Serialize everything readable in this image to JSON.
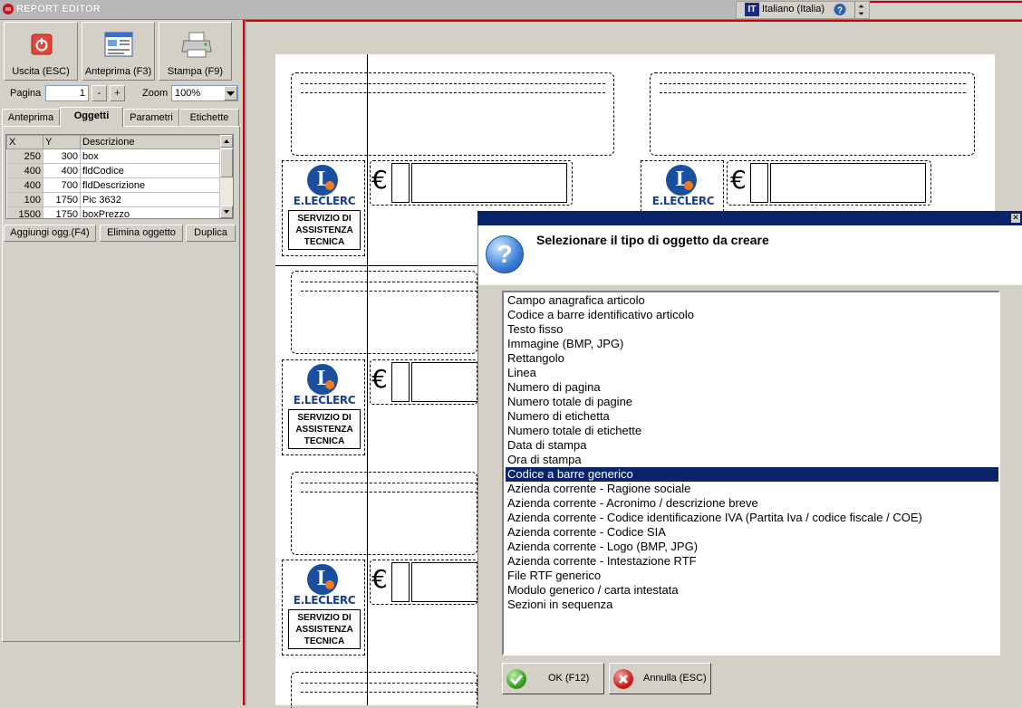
{
  "window": {
    "title": "REPORT EDITOR",
    "language_code": "IT",
    "language_name": "Italiano (Italia)"
  },
  "toolbar": {
    "exit_label": "Uscita (ESC)",
    "preview_label": "Anteprima (F3)",
    "print_label": "Stampa (F9)"
  },
  "nav": {
    "page_label": "Pagina",
    "page_value": "1",
    "minus_label": "-",
    "plus_label": "+",
    "zoom_label": "Zoom",
    "zoom_value": "100%"
  },
  "tabs": [
    {
      "label": "Anteprima"
    },
    {
      "label": "Oggetti"
    },
    {
      "label": "Parametri"
    },
    {
      "label": "Etichette"
    }
  ],
  "grid": {
    "headers": [
      "X",
      "Y",
      "Descrizione"
    ],
    "rows": [
      {
        "x": "250",
        "y": "300",
        "desc": "box"
      },
      {
        "x": "400",
        "y": "400",
        "desc": "fldCodice"
      },
      {
        "x": "400",
        "y": "700",
        "desc": "fldDescrizione"
      },
      {
        "x": "100",
        "y": "1750",
        "desc": "Pic 3632"
      },
      {
        "x": "1500",
        "y": "1750",
        "desc": "boxPrezzo"
      }
    ]
  },
  "actions": {
    "add_label": "Aggiungi ogg.(F4)",
    "delete_label": "Elimina oggetto",
    "duplicate_label": "Duplica"
  },
  "label_template": {
    "brand": "E.LECLERC",
    "service_line1": "SERVIZIO DI",
    "service_line2": "ASSISTENZA",
    "service_line3": "TECNICA",
    "currency": "€"
  },
  "dialog": {
    "heading": "Selezionare il tipo di oggetto da creare",
    "selected_index": 12,
    "items": [
      "Campo anagrafica articolo",
      "Codice a barre identificativo articolo",
      "Testo fisso",
      "Immagine (BMP, JPG)",
      "Rettangolo",
      "Linea",
      "Numero di pagina",
      "Numero totale di pagine",
      "Numero di etichetta",
      "Numero totale di etichette",
      "Data di stampa",
      "Ora di stampa",
      "Codice a barre generico",
      "Azienda corrente - Ragione sociale",
      "Azienda corrente - Acronimo / descrizione breve",
      "Azienda corrente - Codice identificazione IVA (Partita Iva / codice fiscale / COE)",
      "Azienda corrente - Codice SIA",
      "Azienda corrente - Logo (BMP, JPG)",
      "Azienda corrente - Intestazione RTF",
      "File RTF generico",
      "Modulo generico / carta intestata",
      "Sezioni in sequenza"
    ],
    "ok_label": "OK (F12)",
    "cancel_label": "Annulla (ESC)"
  },
  "icons": {
    "exit": "power-icon",
    "preview": "window-preview-icon",
    "print": "printer-icon",
    "help": "help-icon",
    "question": "question-icon",
    "ok": "check-icon",
    "cancel": "x-icon"
  },
  "colors": {
    "selection": "#0a246a",
    "dialog_title": "#0a246a",
    "brand_blue": "#1a3f8a",
    "brand_orange": "#f07b1f"
  }
}
